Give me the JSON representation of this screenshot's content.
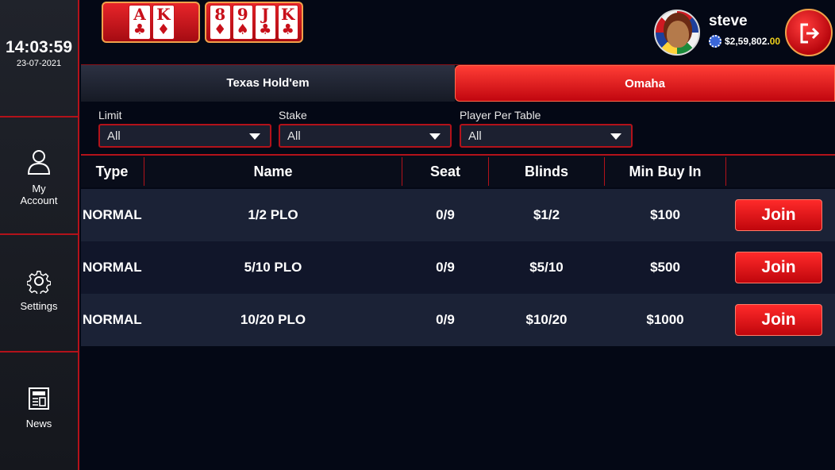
{
  "clock": {
    "time": "14:03:59",
    "date": "23-07-2021"
  },
  "sidebar": {
    "items": [
      {
        "label_line1": "My",
        "label_line2": "Account",
        "icon": "user-icon"
      },
      {
        "label_line1": "Settings",
        "label_line2": "",
        "icon": "gear-icon"
      },
      {
        "label_line1": "News",
        "label_line2": "",
        "icon": "newspaper-icon"
      }
    ]
  },
  "header": {
    "hand1": [
      {
        "rank": "A",
        "suit": "♣"
      },
      {
        "rank": "K",
        "suit": "♦"
      }
    ],
    "hand2": [
      {
        "rank": "8",
        "suit": "♦"
      },
      {
        "rank": "9",
        "suit": "♠"
      },
      {
        "rank": "J",
        "suit": "♣"
      },
      {
        "rank": "K",
        "suit": "♣"
      }
    ],
    "username": "steve",
    "balance_main": "$2,59,802.",
    "balance_cents": "00"
  },
  "tabs": [
    {
      "label": "Texas Hold'em",
      "active": false
    },
    {
      "label": "Omaha",
      "active": true
    }
  ],
  "filters": [
    {
      "label": "Limit",
      "value": "All"
    },
    {
      "label": "Stake",
      "value": "All"
    },
    {
      "label": "Player Per Table",
      "value": "All"
    }
  ],
  "table": {
    "headers": [
      "Type",
      "Name",
      "Seat",
      "Blinds",
      "Min Buy In"
    ],
    "join_label": "Join",
    "rows": [
      {
        "type": "NORMAL",
        "name": "1/2 PLO",
        "seat": "0/9",
        "blinds": "$1/2",
        "min_buy_in": "$100"
      },
      {
        "type": "NORMAL",
        "name": "5/10 PLO",
        "seat": "0/9",
        "blinds": "$5/10",
        "min_buy_in": "$500"
      },
      {
        "type": "NORMAL",
        "name": "10/20 PLO",
        "seat": "0/9",
        "blinds": "$10/20",
        "min_buy_in": "$1000"
      }
    ]
  },
  "colors": {
    "accent": "#e0141c",
    "background": "#040815",
    "row_odd": "#1b2236",
    "row_even": "#11162a"
  }
}
